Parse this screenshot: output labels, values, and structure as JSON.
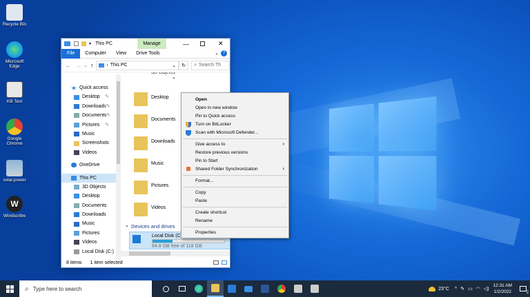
{
  "desktop_icons": [
    {
      "label": "Recycle Bin",
      "color": "#dfe7ef"
    },
    {
      "label": "Microsoft Edge",
      "color": "#1ba1e2"
    },
    {
      "label": "KB Test",
      "color": "#e8e8e8"
    },
    {
      "label": "Google Chrome",
      "color": "#e34133"
    },
    {
      "label": "solar.power",
      "color": "#c7d2da"
    },
    {
      "label": "Windscribe",
      "color": "#222"
    }
  ],
  "explorer": {
    "title": "This PC",
    "manage_tab": "Manage",
    "tabs": [
      "File",
      "Computer",
      "View",
      "Drive Tools"
    ],
    "address": "This PC",
    "search_placeholder": "Search Th",
    "quick_access": "Quick access",
    "nav_items": [
      "Desktop",
      "Downloads",
      "Documents",
      "Pictures",
      "Music",
      "Screenshots",
      "Videos"
    ],
    "onedrive": "OneDrive",
    "this_pc": "This PC",
    "pc_items": [
      "3D Objects",
      "Desktop",
      "Documents",
      "Downloads",
      "Music",
      "Pictures",
      "Videos",
      "Local Disk (C:)"
    ],
    "partial_folder": "3D Objects",
    "folders": [
      "Desktop",
      "Documents",
      "Downloads",
      "Music",
      "Pictures",
      "Videos"
    ],
    "group_header": "Devices and drives",
    "drive_name": "Local Disk (C:)",
    "drive_free": "84.8 GB free of 118 GB",
    "drive_used_fraction": 0.28,
    "status_items": "8 items",
    "status_selected": "1 item selected"
  },
  "context_menu": {
    "items": [
      "Open",
      "Open in new window",
      "Pin to Quick access",
      "Turn on BitLocker",
      "Scan with Microsoft Defender...",
      "Give access to",
      "Restore previous versions",
      "Pin to Start",
      "Shared Folder Synchronization",
      "Format...",
      "Copy",
      "Paste",
      "Create shortcut",
      "Rename",
      "Properties"
    ]
  },
  "taskbar": {
    "search_placeholder": "Type here to search",
    "weather": "23°C",
    "time": "12:31 AM",
    "date": "1/2/2022",
    "notification_count": "2"
  }
}
